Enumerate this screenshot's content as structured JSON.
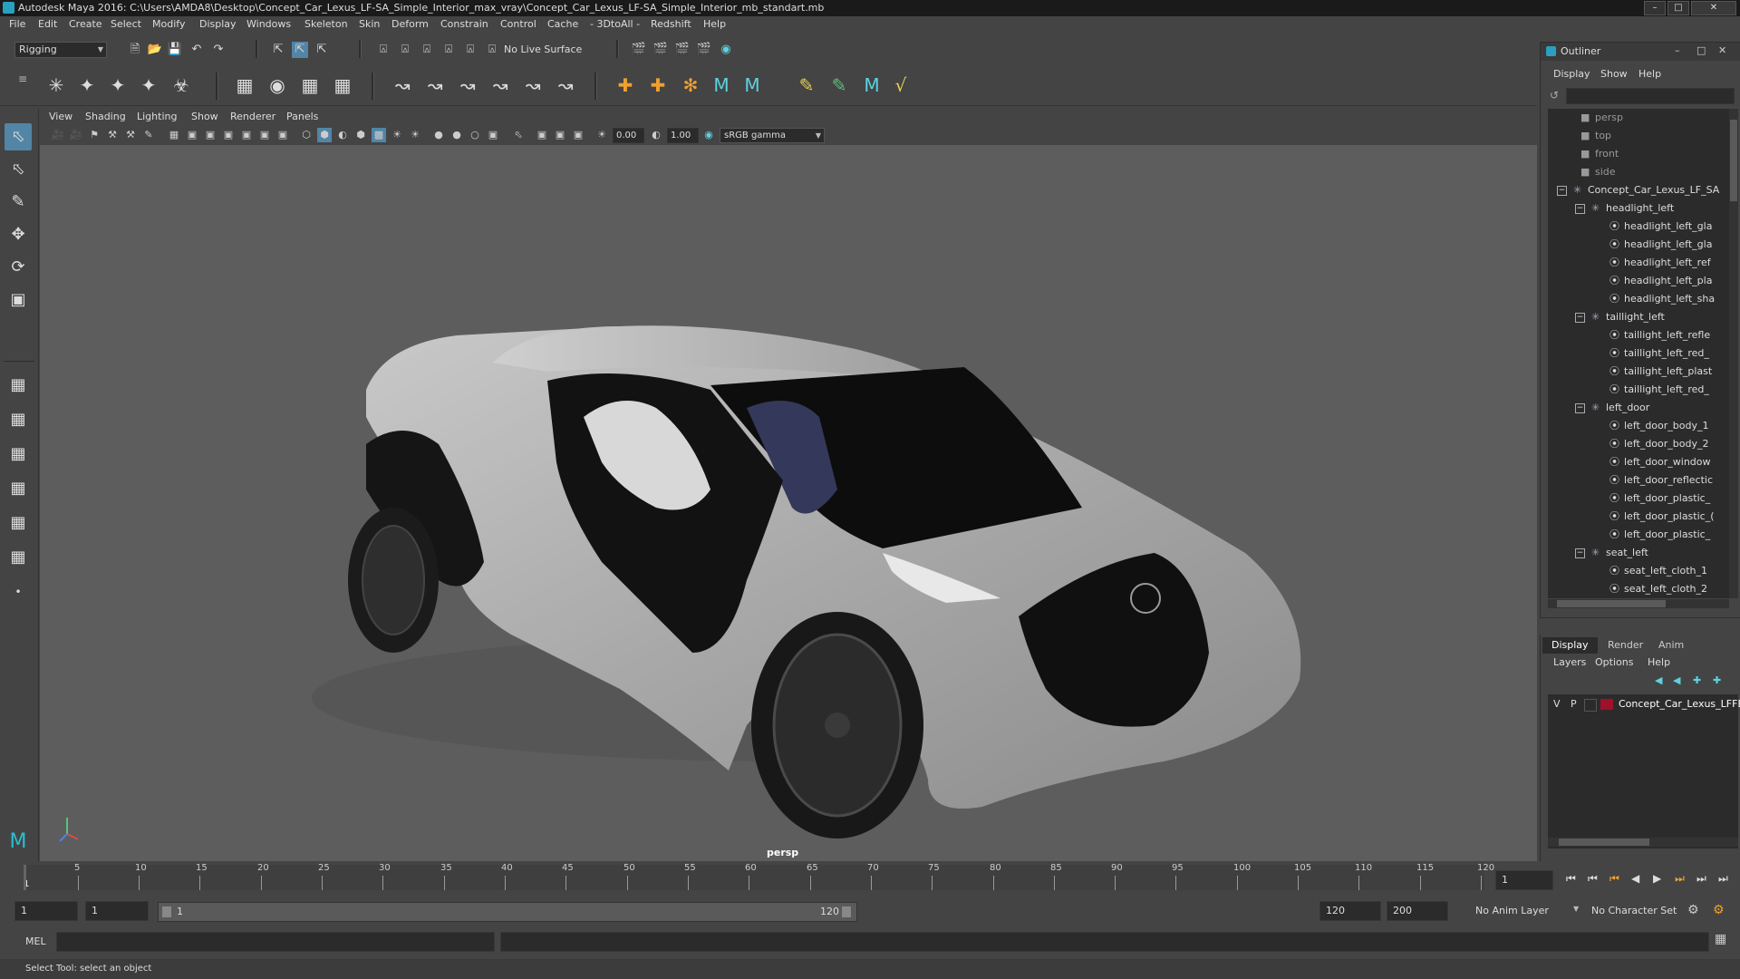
{
  "window": {
    "title": "Autodesk Maya 2016: C:\\Users\\AMDA8\\Desktop\\Concept_Car_Lexus_LF-SA_Simple_Interior_max_vray\\Concept_Car_Lexus_LF-SA_Simple_Interior_mb_standart.mb",
    "minimize_icon": "minimize-icon",
    "maximize_icon": "maximize-icon",
    "close_icon": "close-icon"
  },
  "menubar": [
    "File",
    "Edit",
    "Create",
    "Select",
    "Modify",
    "Display",
    "Windows",
    "Skeleton",
    "Skin",
    "Deform",
    "Constrain",
    "Control",
    "Cache",
    "- 3DtoAll -",
    "Redshift",
    "Help"
  ],
  "statusline": {
    "mode": "Rigging",
    "live_surface": "No Live Surface"
  },
  "panel_menu": [
    "View",
    "Shading",
    "Lighting",
    "Show",
    "Renderer",
    "Panels"
  ],
  "view_toolbar": {
    "exposure": "0.00",
    "gamma": "1.00",
    "color_space": "sRGB gamma"
  },
  "viewport": {
    "camera_label": "persp"
  },
  "outliner": {
    "title": "Outliner",
    "menu": [
      "Display",
      "Show",
      "Help"
    ],
    "items": [
      {
        "label": "persp",
        "level": 0,
        "type": "camera"
      },
      {
        "label": "top",
        "level": 0,
        "type": "camera"
      },
      {
        "label": "front",
        "level": 0,
        "type": "camera"
      },
      {
        "label": "side",
        "level": 0,
        "type": "camera"
      },
      {
        "label": "Concept_Car_Lexus_LF_SA",
        "level": 0,
        "type": "group"
      },
      {
        "label": "headlight_left",
        "level": 1,
        "type": "group"
      },
      {
        "label": "headlight_left_gla",
        "level": 2,
        "type": "mesh"
      },
      {
        "label": "headlight_left_gla",
        "level": 2,
        "type": "mesh"
      },
      {
        "label": "headlight_left_ref",
        "level": 2,
        "type": "mesh"
      },
      {
        "label": "headlight_left_pla",
        "level": 2,
        "type": "mesh"
      },
      {
        "label": "headlight_left_sha",
        "level": 2,
        "type": "mesh"
      },
      {
        "label": "taillight_left",
        "level": 1,
        "type": "group"
      },
      {
        "label": "taillight_left_refle",
        "level": 2,
        "type": "mesh"
      },
      {
        "label": "taillight_left_red_",
        "level": 2,
        "type": "mesh"
      },
      {
        "label": "taillight_left_plast",
        "level": 2,
        "type": "mesh"
      },
      {
        "label": "taillight_left_red_",
        "level": 2,
        "type": "mesh"
      },
      {
        "label": "left_door",
        "level": 1,
        "type": "group"
      },
      {
        "label": "left_door_body_1",
        "level": 2,
        "type": "mesh"
      },
      {
        "label": "left_door_body_2",
        "level": 2,
        "type": "mesh"
      },
      {
        "label": "left_door_window",
        "level": 2,
        "type": "mesh"
      },
      {
        "label": "left_door_reflectic",
        "level": 2,
        "type": "mesh"
      },
      {
        "label": "left_door_plastic_",
        "level": 2,
        "type": "mesh"
      },
      {
        "label": "left_door_plastic_(",
        "level": 2,
        "type": "mesh"
      },
      {
        "label": "left_door_plastic_",
        "level": 2,
        "type": "mesh"
      },
      {
        "label": "seat_left",
        "level": 1,
        "type": "group"
      },
      {
        "label": "seat_left_cloth_1",
        "level": 2,
        "type": "mesh"
      },
      {
        "label": "seat_left_cloth_2",
        "level": 2,
        "type": "mesh"
      }
    ]
  },
  "layers": {
    "tabs": [
      "Display",
      "Render",
      "Anim"
    ],
    "menu": [
      "Layers",
      "Options",
      "Help"
    ],
    "layer": {
      "v": "V",
      "p": "P",
      "name": "Concept_Car_Lexus_LFFE",
      "color": "#a0102a"
    }
  },
  "timeline": {
    "ticks": [
      "5",
      "10",
      "15",
      "20",
      "25",
      "30",
      "35",
      "40",
      "45",
      "50",
      "55",
      "60",
      "65",
      "70",
      "75",
      "80",
      "85",
      "90",
      "95",
      "100",
      "105",
      "110",
      "115",
      "120"
    ],
    "start_tick": "1",
    "current_frame": "1"
  },
  "range": {
    "start": "1",
    "playback_start": "1",
    "slider_start": "1",
    "slider_end": "120",
    "playback_end": "120",
    "end": "200",
    "anim_layer": "No Anim Layer",
    "character_set": "No Character Set"
  },
  "command": {
    "label": "MEL"
  },
  "help_line": "Select Tool: select an object",
  "colors": {
    "accent": "#5285a6",
    "viewport_bg": "#5d5d5d",
    "layer_color": "#a0102a"
  }
}
